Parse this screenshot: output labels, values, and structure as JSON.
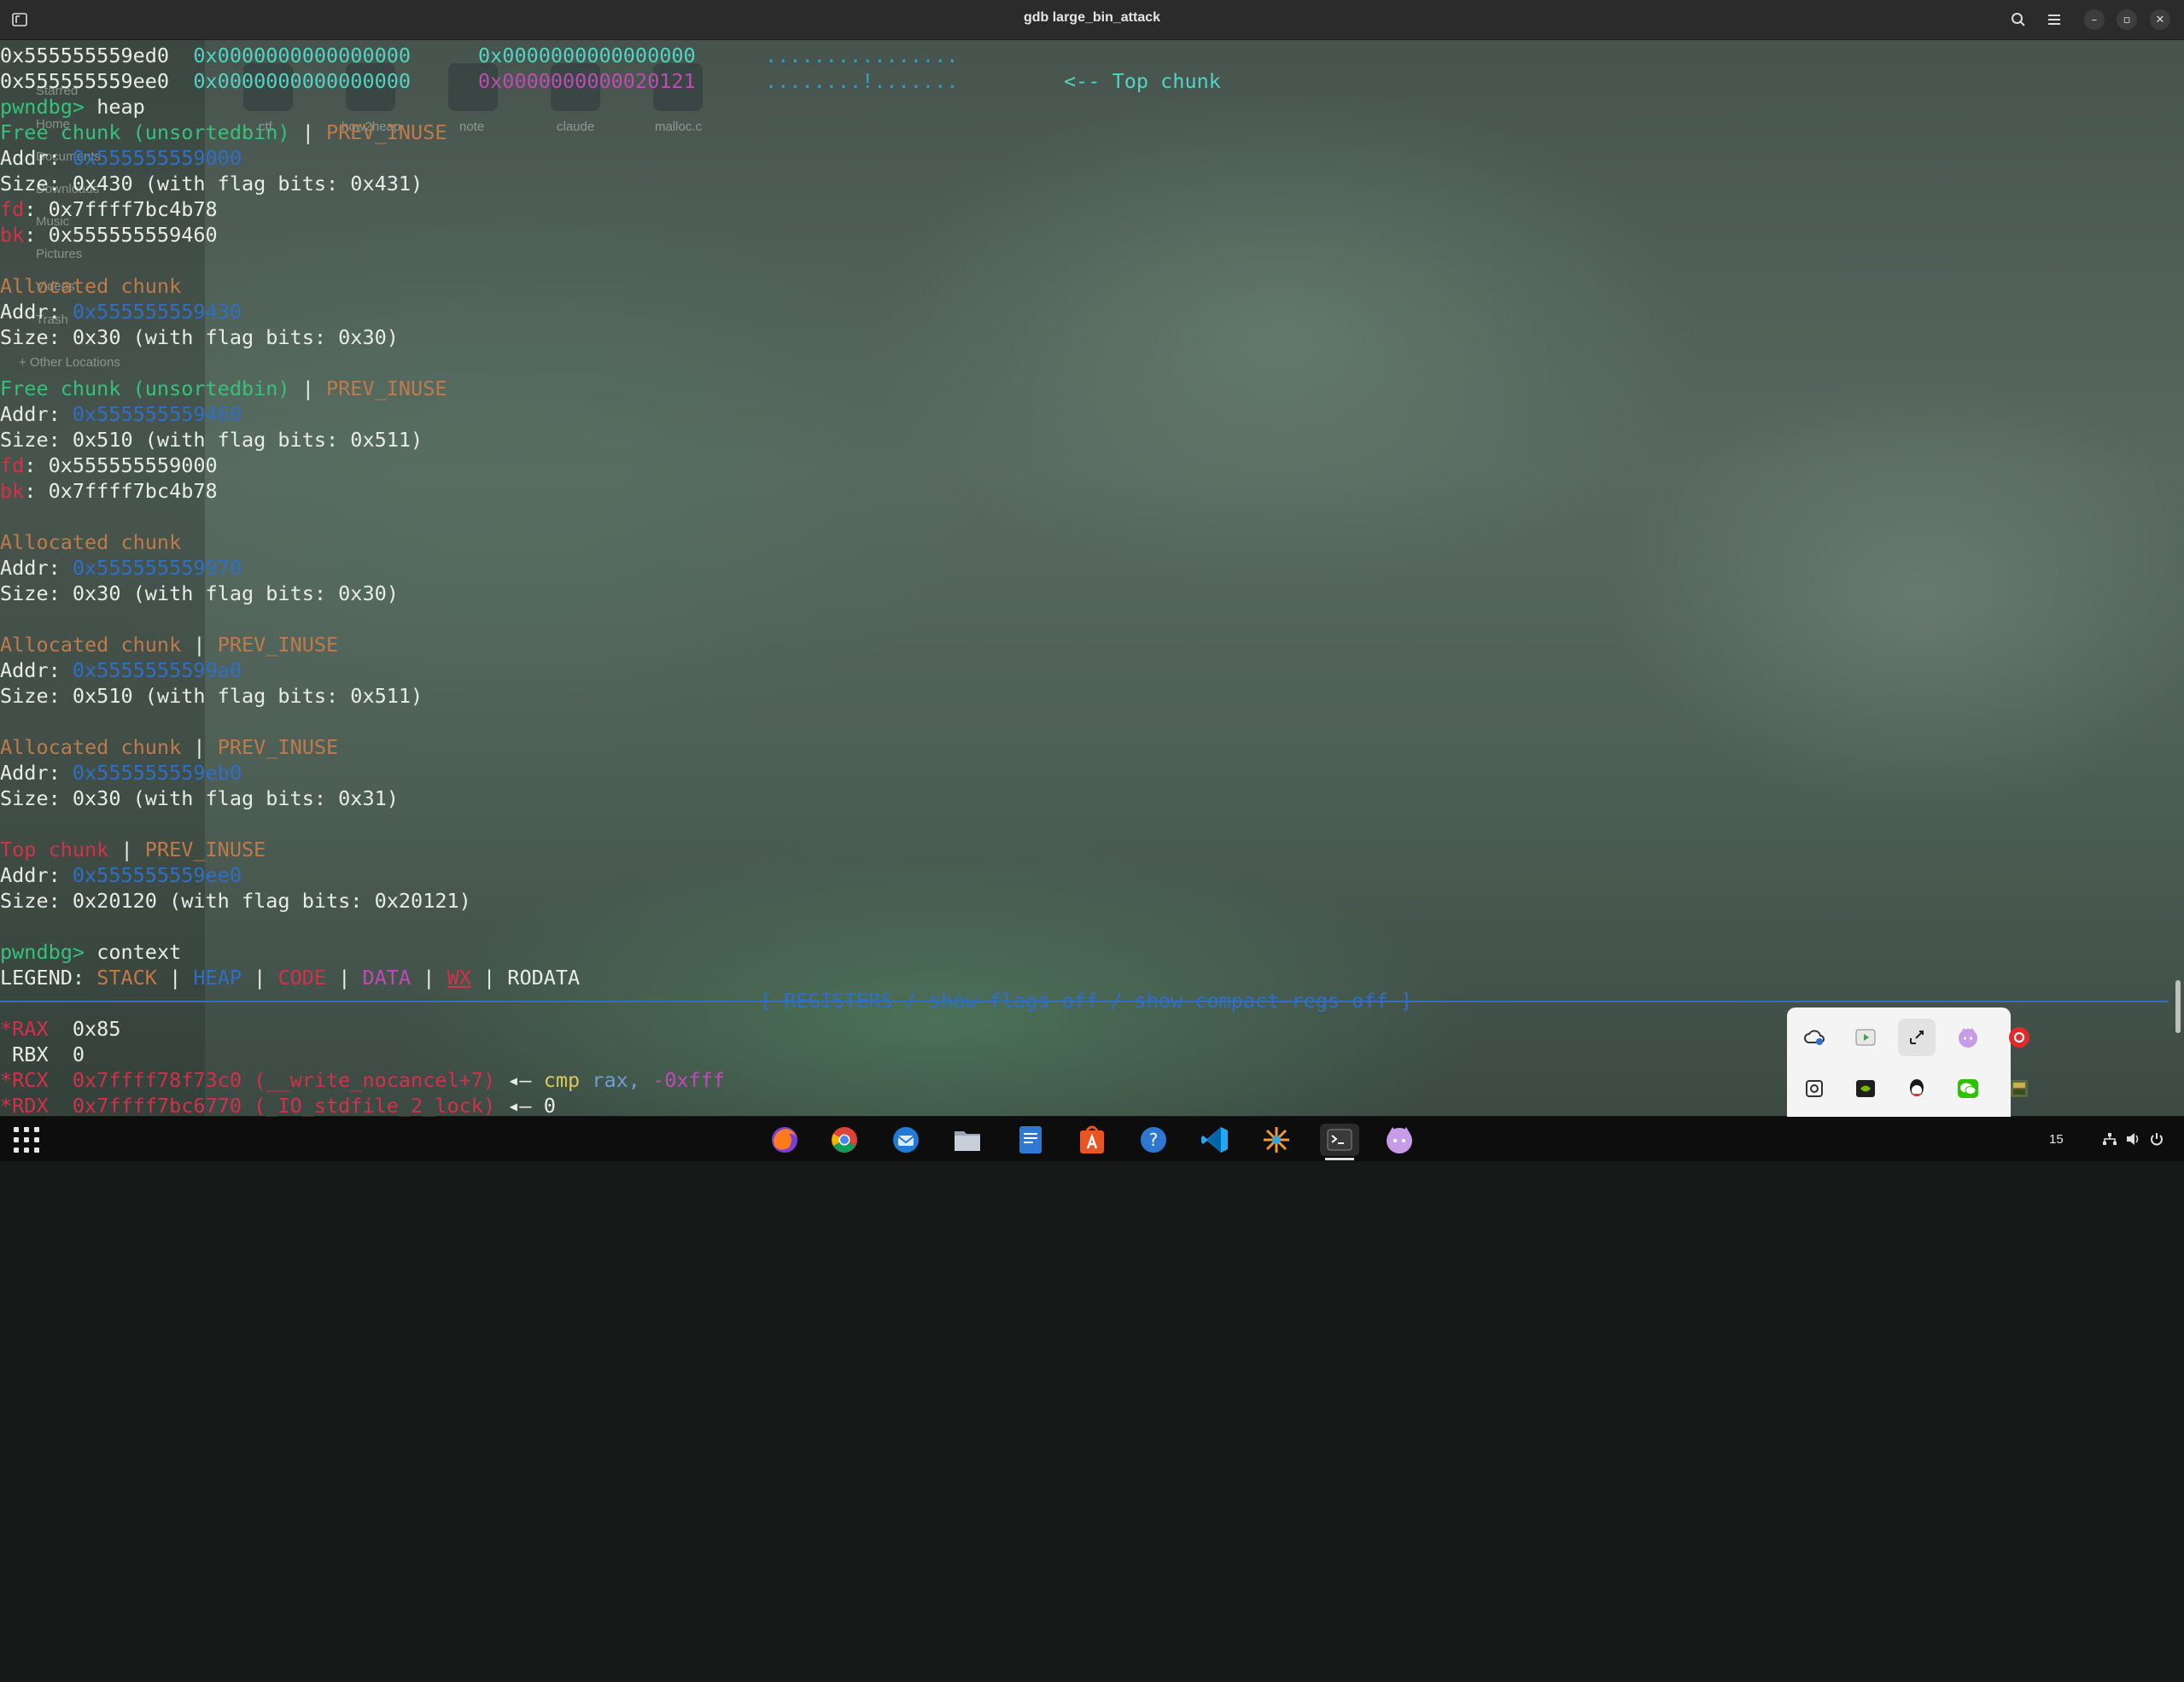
{
  "window": {
    "title": "gdb large_bin_attack"
  },
  "ghost_files": {
    "sidebar": [
      "Starred",
      "Home",
      "Documents",
      "Downloads",
      "Music",
      "Pictures",
      "Videos",
      "Trash",
      "+ Other Locations"
    ],
    "icons": [
      "ctf",
      "how2heap",
      "note",
      "claude",
      "malloc.c"
    ]
  },
  "terminal": {
    "hexdump": [
      {
        "addr": "0x555555559ed0",
        "q1": "0x0000000000000000",
        "q2": "0x0000000000000000",
        "ascii": "................",
        "note": ""
      },
      {
        "addr": "0x555555559ee0",
        "q1": "0x0000000000000000",
        "q2": "0x0000000000020121",
        "ascii": "........!.......",
        "note": "<-- Top chunk"
      }
    ],
    "prompt": "pwndbg>",
    "cmd_heap": "heap",
    "chunks": [
      {
        "kind": "Free chunk (unsortedbin)",
        "flag": "PREV_INUSE",
        "addr": "0x555555559000",
        "size": "0x430 (with flag bits: 0x431)",
        "fd": "0x7ffff7bc4b78",
        "bk": "0x555555559460"
      },
      {
        "kind": "Allocated chunk",
        "flag": "",
        "addr": "0x555555559430",
        "size": "0x30 (with flag bits: 0x30)"
      },
      {
        "kind": "Free chunk (unsortedbin)",
        "flag": "PREV_INUSE",
        "addr": "0x555555559460",
        "size": "0x510 (with flag bits: 0x511)",
        "fd": "0x555555559000",
        "bk": "0x7ffff7bc4b78"
      },
      {
        "kind": "Allocated chunk",
        "flag": "",
        "addr": "0x555555559970",
        "size": "0x30 (with flag bits: 0x30)"
      },
      {
        "kind": "Allocated chunk",
        "flag": "PREV_INUSE",
        "addr": "0x5555555599a0",
        "size": "0x510 (with flag bits: 0x511)"
      },
      {
        "kind": "Allocated chunk",
        "flag": "PREV_INUSE",
        "addr": "0x555555559eb0",
        "size": "0x30 (with flag bits: 0x31)"
      },
      {
        "kind": "Top chunk",
        "flag": "PREV_INUSE",
        "addr": "0x555555559ee0",
        "size": "0x20120 (with flag bits: 0x20121)"
      }
    ],
    "labels": {
      "addr": "Addr: ",
      "size": "Size: ",
      "fd": "fd",
      "bk": "bk",
      "sep": " | "
    },
    "cmd_context": "context",
    "legend": {
      "label": "LEGEND:",
      "stack": "STACK",
      "heap": "HEAP",
      "code": "CODE",
      "data": "DATA",
      "wx": "WX",
      "rodata": "RODATA"
    },
    "registers_header": "[ REGISTERS / show-flags off / show-compact-regs off ]",
    "registers": [
      {
        "name": "*RAX",
        "value": "0x85",
        "sym": "",
        "arrow": "",
        "insn": "",
        "ops": "",
        "extra": ""
      },
      {
        "name": " RBX",
        "value": "0",
        "sym": "",
        "arrow": "",
        "insn": "",
        "ops": "",
        "extra": ""
      },
      {
        "name": "*RCX",
        "value": "0x7ffff78f73c0",
        "sym": "(__write_nocancel+7)",
        "arrow": "◂— ",
        "insn": "cmp",
        "ops": " rax, ",
        "extra": "-0xfff"
      },
      {
        "name": "*RDX",
        "value": "0x7ffff7bc6770",
        "sym": "(_IO_stdfile_2_lock)",
        "arrow": "◂— ",
        "insn": "",
        "ops": "0",
        "extra": ""
      }
    ]
  },
  "taskbar": {
    "apps": [
      "firefox-icon",
      "chrome-icon",
      "thunderbird-icon",
      "files-icon",
      "text-editor-icon",
      "app-store-icon",
      "help-icon",
      "vscode-icon",
      "settings-sun-icon",
      "terminal-icon",
      "cat-app-icon"
    ],
    "clock_fragment": "15"
  },
  "colors": {
    "stack": "#c07a4a",
    "heap": "#2f6fc5",
    "code": "#d4304a",
    "data": "#c04bb8",
    "prompt": "#35c27a"
  }
}
